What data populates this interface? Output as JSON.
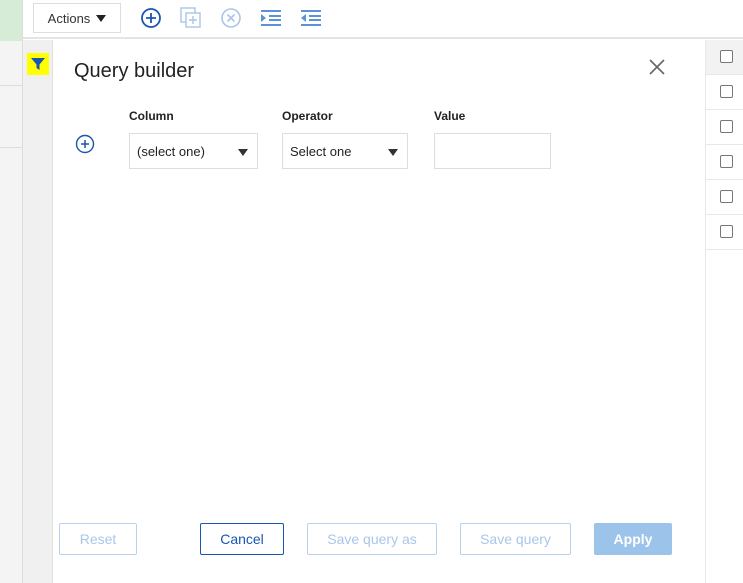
{
  "toolbar": {
    "actions_label": "Actions"
  },
  "panel": {
    "title": "Query builder",
    "column_label": "Column",
    "operator_label": "Operator",
    "value_label": "Value",
    "column_value": "(select one)",
    "operator_value": "Select one",
    "value_value": ""
  },
  "buttons": {
    "reset": "Reset",
    "cancel": "Cancel",
    "save_as": "Save query as",
    "save": "Save query",
    "apply": "Apply"
  },
  "colors": {
    "accent": "#1a56b0",
    "filter_highlight": "#ffff00",
    "apply_bg": "#9cc3ea"
  }
}
